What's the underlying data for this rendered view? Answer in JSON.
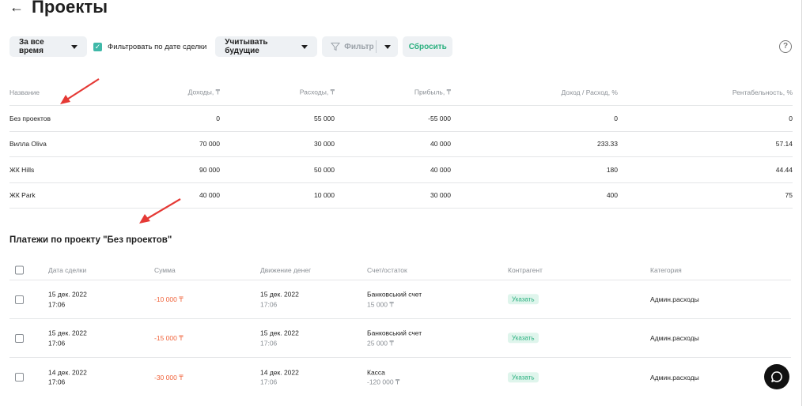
{
  "header": {
    "back_icon": "arrow-left-icon",
    "title": "Проекты"
  },
  "toolbar": {
    "period_label": "За все время",
    "filter_by_deal_date_label": "Фильтровать по дате сделки",
    "filter_by_deal_date_checked": true,
    "future_label": "Учитывать будущие",
    "filter_label": "Фильтр",
    "reset_label": "Сбросить",
    "help_symbol": "?",
    "accent_color": "#3fb8a8"
  },
  "projects_table": {
    "headers": {
      "name": "Название",
      "income": "Доходы, ₸",
      "expense": "Расходы, ₸",
      "profit": "Прибыль, ₸",
      "ratio": "Доход / Расход, %",
      "profitability": "Рентабельность, %"
    },
    "rows": [
      {
        "name": "Без проектов",
        "income": "0",
        "expense": "55 000",
        "profit": "-55 000",
        "ratio": "0",
        "profitability": "0"
      },
      {
        "name": "Вилла Oliva",
        "income": "70 000",
        "expense": "30 000",
        "profit": "40 000",
        "ratio": "233.33",
        "profitability": "57.14"
      },
      {
        "name": "ЖК Hills",
        "income": "90 000",
        "expense": "50 000",
        "profit": "40 000",
        "ratio": "180",
        "profitability": "44.44"
      },
      {
        "name": "ЖК Park",
        "income": "40 000",
        "expense": "10 000",
        "profit": "30 000",
        "ratio": "400",
        "profitability": "75"
      }
    ]
  },
  "payments": {
    "section_title": "Платежи по проекту \"Без проектов\"",
    "headers": {
      "deal_date": "Дата сделки",
      "amount": "Сумма",
      "movement": "Движение денег",
      "account": "Счет/остаток",
      "counterparty": "Контрагент",
      "category": "Категория"
    },
    "rows": [
      {
        "deal_date": "15 дек. 2022",
        "deal_time": "17:06",
        "amount": "-10 000 ₸",
        "move_date": "15 дек. 2022",
        "move_time": "17:06",
        "account": "Банковський счет",
        "balance": "15 000 ₸",
        "counterparty": "Указать",
        "category": "Админ.расходы"
      },
      {
        "deal_date": "15 дек. 2022",
        "deal_time": "17:06",
        "amount": "-15 000 ₸",
        "move_date": "15 дек. 2022",
        "move_time": "17:06",
        "account": "Банковський счет",
        "balance": "25 000 ₸",
        "counterparty": "Указать",
        "category": "Админ.расходы"
      },
      {
        "deal_date": "14 дек. 2022",
        "deal_time": "17:06",
        "amount": "-30 000 ₸",
        "move_date": "14 дек. 2022",
        "move_time": "17:06",
        "account": "Касса",
        "balance": "-120 000 ₸",
        "counterparty": "Указать",
        "category": "Админ.расходы"
      }
    ]
  },
  "colors": {
    "negative": "#f0643c",
    "badge_text": "#2bb07f",
    "annotation_arrow": "#e53935"
  },
  "chat": {
    "icon": "chat-bubble-icon"
  }
}
